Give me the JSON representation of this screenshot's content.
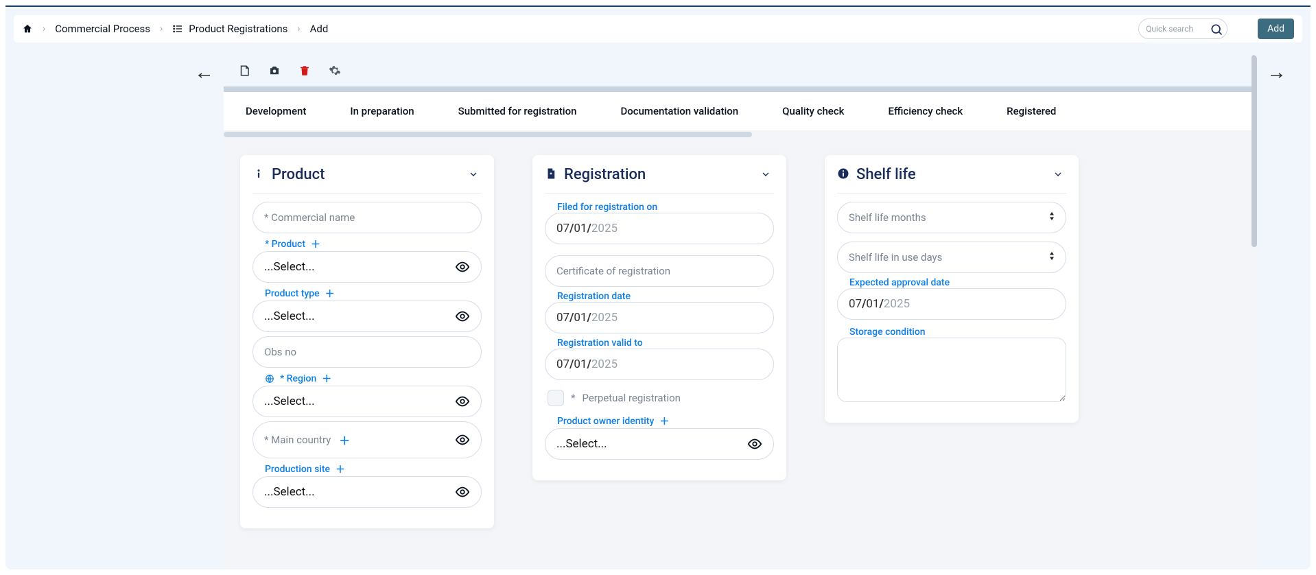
{
  "breadcrumb": {
    "level1": "Commercial Process",
    "level2": "Product Registrations",
    "level3": "Add"
  },
  "search": {
    "placeholder": "Quick search"
  },
  "buttons": {
    "add": "Add"
  },
  "stages": {
    "s1": "Development",
    "s2": "In preparation",
    "s3": "Submitted for registration",
    "s4": "Documentation validation",
    "s5": "Quality check",
    "s6": "Efficiency check",
    "s7": "Registered"
  },
  "placeholders": {
    "select": "...Select..."
  },
  "product": {
    "panel_title": "Product",
    "commercial_name_ph": "* Commercial name",
    "product_label": "* Product",
    "product_type_label": "Product type",
    "obs_no_ph": "Obs no",
    "region_label": "* Region",
    "main_country_ph": "* Main country",
    "production_site_label": "Production site"
  },
  "registration": {
    "panel_title": "Registration",
    "filed_for_label": "Filed for registration on",
    "filed_for_dd": "07",
    "filed_for_mm": "01",
    "filed_for_yyyy": "2025",
    "certificate_ph": "Certificate of registration",
    "reg_date_label": "Registration date",
    "reg_date_dd": "07",
    "reg_date_mm": "01",
    "reg_date_yyyy": "2025",
    "valid_to_label": "Registration valid to",
    "valid_to_dd": "07",
    "valid_to_mm": "01",
    "valid_to_yyyy": "2025",
    "perpetual_label": "Perpetual registration",
    "owner_label": "Product owner identity"
  },
  "shelf": {
    "panel_title": "Shelf life",
    "months_ph": "Shelf life months",
    "days_ph": "Shelf life in use days",
    "expected_label": "Expected approval date",
    "expected_dd": "07",
    "expected_mm": "01",
    "expected_yyyy": "2025",
    "storage_label": "Storage condition"
  }
}
